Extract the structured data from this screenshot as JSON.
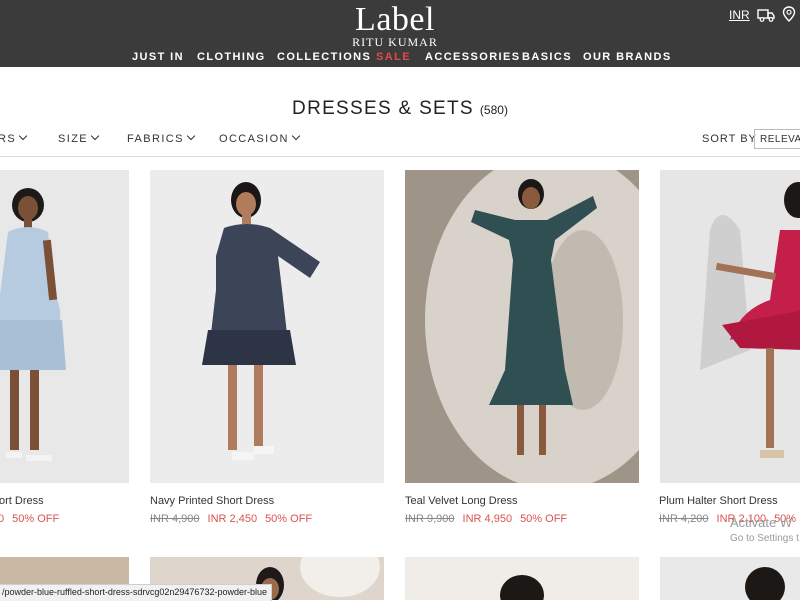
{
  "header": {
    "logo_main": "Label",
    "logo_sub": "RITU KUMAR",
    "currency": "INR",
    "nav": [
      "JUST IN",
      "CLOTHING",
      "COLLECTIONS",
      "SALE",
      "ACCESSORIES",
      "BASICS",
      "OUR BRANDS"
    ]
  },
  "page": {
    "title": "DRESSES & SETS",
    "count": "(580)"
  },
  "filters": [
    "RS",
    "SIZE",
    "FABRICS",
    "OCCASION"
  ],
  "sort": {
    "label": "SORT BY",
    "value": "RELEVANCE"
  },
  "products": [
    {
      "name": "ort Dress",
      "old_price": "",
      "new_price": "0",
      "discount": "50% OFF"
    },
    {
      "name": "Navy Printed Short Dress",
      "old_price": "INR 4,900",
      "new_price": "INR 2,450",
      "discount": "50% OFF"
    },
    {
      "name": "Teal Velvet Long Dress",
      "old_price": "INR 9,900",
      "new_price": "INR 4,950",
      "discount": "50% OFF"
    },
    {
      "name": "Plum Halter Short Dress",
      "old_price": "INR 4,200",
      "new_price": "INR 2,100",
      "discount": "50%"
    }
  ],
  "status_url": "/powder-blue-ruffled-short-dress-sdrvcg02n29476732-powder-blue",
  "watermark": {
    "title": "Activate W",
    "sub": "Go to Settings t"
  },
  "colors": {
    "header_bg": "#3b3b3b",
    "sale": "#e04a4a",
    "discount": "#d9534f"
  }
}
